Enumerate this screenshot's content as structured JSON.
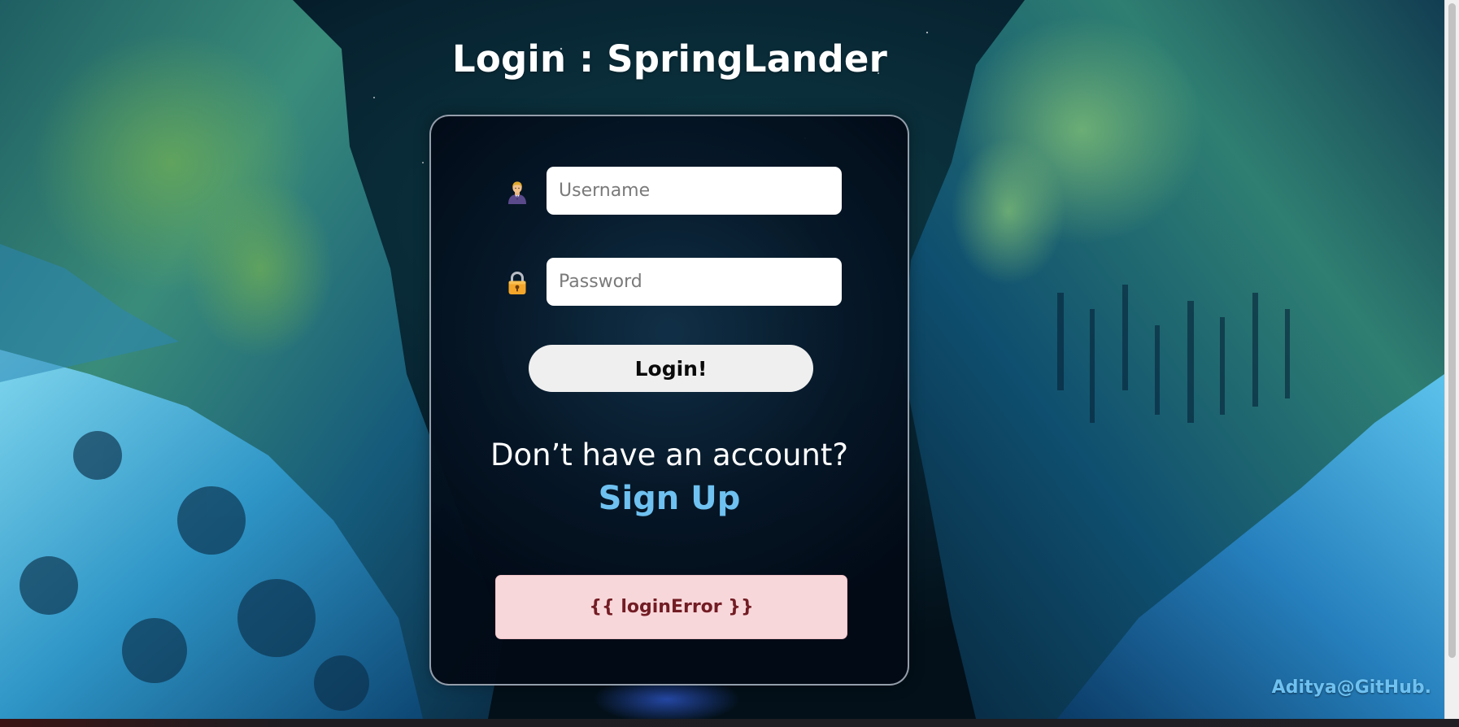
{
  "header": {
    "title": "Login : SpringLander"
  },
  "login_form": {
    "username": {
      "icon": "user-icon",
      "placeholder": "Username",
      "value": ""
    },
    "password": {
      "icon": "lock-icon",
      "placeholder": "Password",
      "value": ""
    },
    "submit_label": "Login!",
    "signup_prompt": "Don’t have an account?",
    "signup_link": "Sign Up",
    "error_message": "{{ loginError }}"
  },
  "footer": {
    "credit": "Aditya@GitHub."
  },
  "colors": {
    "link_accent": "#6ec1f0",
    "error_background": "#f8d7da",
    "error_text": "#721c24",
    "button_background": "#efefef"
  }
}
